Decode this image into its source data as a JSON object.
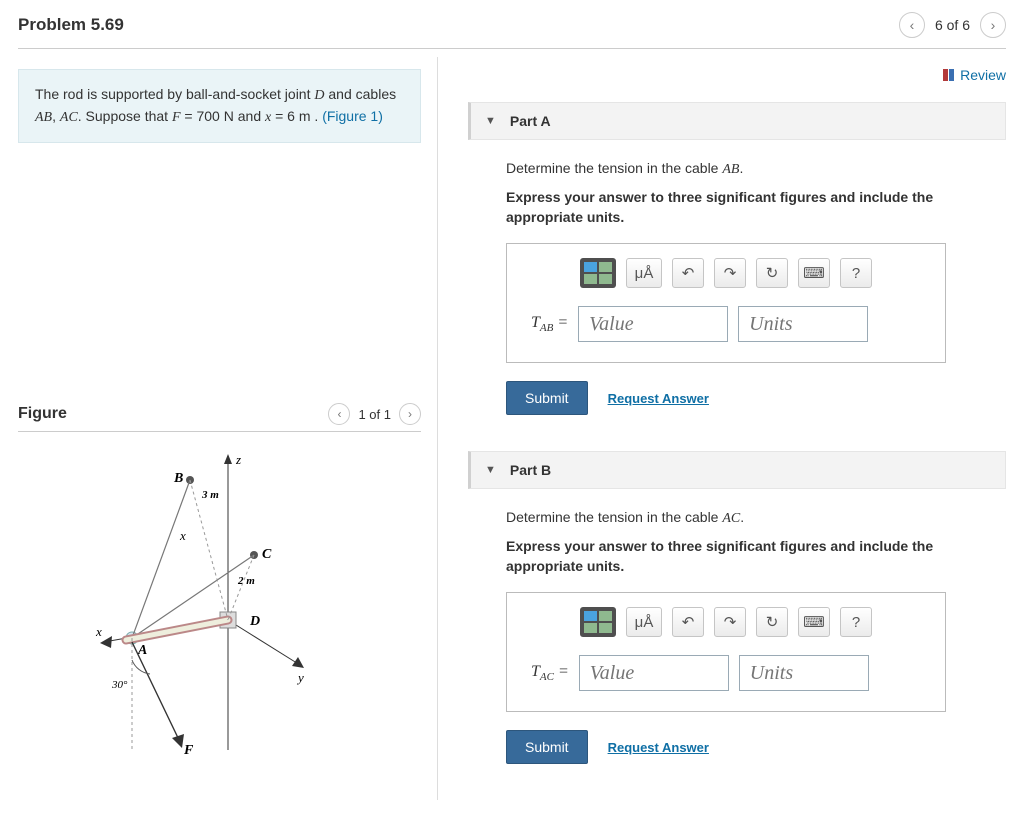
{
  "header": {
    "title": "Problem 5.69",
    "position": "6 of 6"
  },
  "prompt": {
    "text_prefix": "The rod is supported by ball-and-socket joint ",
    "joint": "D",
    "text_mid1": " and cables ",
    "cable1": "AB",
    "cable_sep": ", ",
    "cable2": "AC",
    "text_mid2": ". Suppose that ",
    "var_F": "F",
    "eq_F": " = 700  N",
    "text_and": " and ",
    "var_x": "x",
    "eq_x": " = 6 m",
    "text_period": " . ",
    "fig_link": "(Figure 1)"
  },
  "figure": {
    "title": "Figure",
    "position": "1 of 1"
  },
  "diagram": {
    "z": "z",
    "x_axis": "x",
    "y_axis": "y",
    "A": "A",
    "B": "B",
    "C": "C",
    "D": "D",
    "F": "F",
    "len1": "3 m",
    "len2": "2 m",
    "angle": "30°",
    "x_left": "x"
  },
  "review_label": "Review",
  "parts": {
    "A": {
      "title": "Part A",
      "q_prefix": "Determine the tension in the cable ",
      "q_var": "AB",
      "q_suffix": ".",
      "instruct": "Express your answer to three significant figures and include the appropriate units.",
      "var_label": "T",
      "var_sub": "AB",
      "eq": " = ",
      "value_ph": "Value",
      "units_ph": "Units",
      "submit": "Submit",
      "request": "Request Answer",
      "units_btn": "μÅ",
      "help_btn": "?"
    },
    "B": {
      "title": "Part B",
      "q_prefix": "Determine the tension in the cable ",
      "q_var": "AC",
      "q_suffix": ".",
      "instruct": "Express your answer to three significant figures and include the appropriate units.",
      "var_label": "T",
      "var_sub": "AC",
      "eq": " = ",
      "value_ph": "Value",
      "units_ph": "Units",
      "submit": "Submit",
      "request": "Request Answer",
      "units_btn": "μÅ",
      "help_btn": "?"
    }
  }
}
